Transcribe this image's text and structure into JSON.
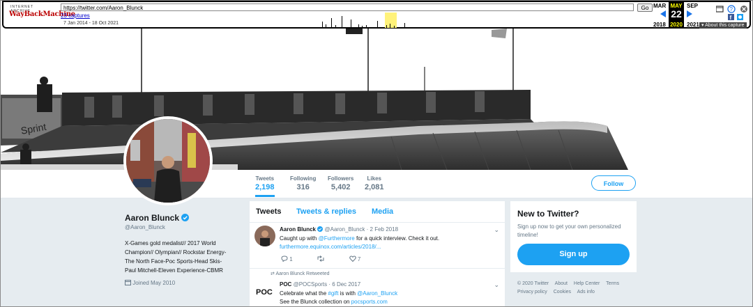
{
  "wayback": {
    "logo_top": "INTERNET ARCHIVE",
    "logo_main": "WayBackMachine",
    "url": "https://twitter.com/Aaron_Blunck",
    "go_label": "Go",
    "captures": "23 captures",
    "range": "7 Jan 2014 - 18 Oct 2021",
    "prev_month": "MAR",
    "cur_month": "MAY",
    "next_month": "SEP",
    "prev_year": "2018",
    "cur_day": "22",
    "cur_year": "2020",
    "next_year": "2021",
    "about": "About this capture"
  },
  "profile": {
    "name": "Aaron Blunck",
    "handle": "@Aaron_Blunck",
    "bio_lines": [
      "X-Games gold medalist// 2017 World",
      "Champion// Olympian// Rockstar Energy-",
      "The North Face-Poc Sports-Head Skis-",
      "Paul Mitchell-Eleven Experience-CBMR"
    ],
    "joined": "Joined May 2010"
  },
  "stats": [
    {
      "label": "Tweets",
      "value": "2,198"
    },
    {
      "label": "Following",
      "value": "316"
    },
    {
      "label": "Followers",
      "value": "5,402"
    },
    {
      "label": "Likes",
      "value": "2,081"
    }
  ],
  "follow_label": "Follow",
  "tabs": [
    "Tweets",
    "Tweets & replies",
    "Media"
  ],
  "tweets": [
    {
      "name": "Aaron Blunck",
      "handle": "@Aaron_Blunck",
      "date": "· 2 Feb 2018",
      "text_pre": "Caught up with ",
      "mention": "@Furthermore",
      "text_post": " for a quick interview. Check it out.",
      "link": "furthermore.equinox.com/articles/2018/...",
      "replies": "1",
      "likes": "7"
    },
    {
      "retweet_label": "Aaron Blunck Retweeted",
      "name": "POC",
      "handle": "@POCSports",
      "date": "· 6 Dec 2017",
      "text_pre": "Celebrate what the ",
      "hashtag": "#gift",
      "text_mid": " is with ",
      "mention": "@Aaron_Blunck",
      "line2_pre": "See the Blunck collection on ",
      "line2_link": "pocsports.com",
      "avatar_text": "POC"
    }
  ],
  "sidebar": {
    "title": "New to Twitter?",
    "subtitle": "Sign up now to get your own personalized timeline!",
    "signup": "Sign up"
  },
  "footer": {
    "row1": [
      "© 2020 Twitter",
      "About",
      "Help Center",
      "Terms"
    ],
    "row2": [
      "Privacy policy",
      "Cookies",
      "Ads info"
    ]
  }
}
